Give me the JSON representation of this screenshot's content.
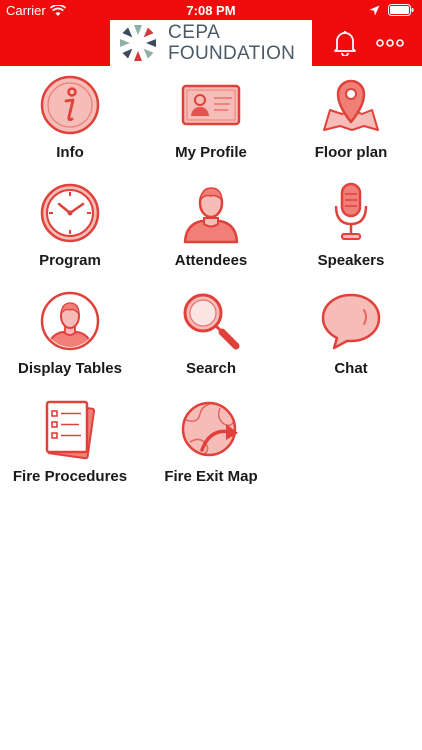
{
  "status_bar": {
    "carrier": "Carrier",
    "time": "7:08 PM"
  },
  "header": {
    "logo_line1": "CEPA",
    "logo_line2": "FOUNDATION",
    "notifications_icon": "bell-icon",
    "more_icon": "more-dots-icon"
  },
  "colors": {
    "brand": "#f00c0c",
    "icon_fill": "#f5bcb8",
    "icon_stroke": "#e0413a"
  },
  "menu": [
    {
      "label": "Info",
      "icon": "info-icon"
    },
    {
      "label": "My Profile",
      "icon": "profile-card-icon"
    },
    {
      "label": "Floor plan",
      "icon": "map-pin-icon"
    },
    {
      "label": "Program",
      "icon": "clock-icon"
    },
    {
      "label": "Attendees",
      "icon": "person-icon"
    },
    {
      "label": "Speakers",
      "icon": "microphone-icon"
    },
    {
      "label": "Display Tables",
      "icon": "avatar-circle-icon"
    },
    {
      "label": "Search",
      "icon": "magnifier-icon"
    },
    {
      "label": "Chat",
      "icon": "chat-bubble-icon"
    },
    {
      "label": "Fire Procedures",
      "icon": "checklist-icon"
    },
    {
      "label": "Fire Exit Map",
      "icon": "exit-globe-icon"
    }
  ]
}
